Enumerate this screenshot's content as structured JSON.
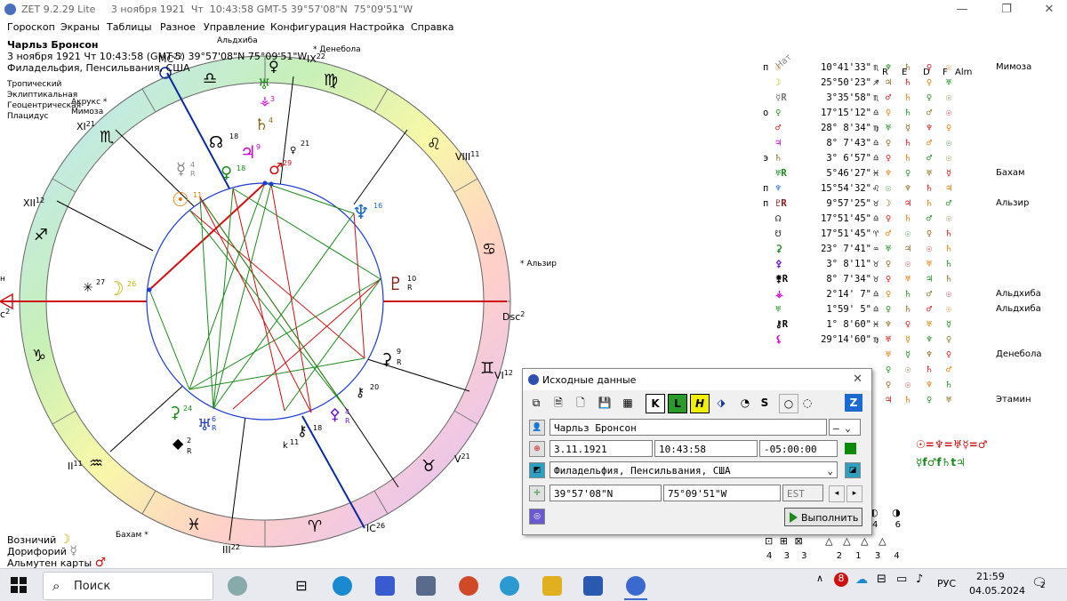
{
  "window": {
    "title": "ZET 9.2.29 Lite     3 ноября 1921  Чт  10:43:58 GMT-5 39°57'08\"N  75°09'51\"W",
    "minimize": "—",
    "restore": "❐",
    "close": "✕"
  },
  "menu": [
    "Гороскоп",
    "Экраны",
    "Таблицы",
    "Разное",
    "Управление",
    "Конфигурация",
    "Настройка",
    "Справка"
  ],
  "person": {
    "name": "Чарльз Бронсон",
    "datetime": "3 ноября 1921  Чт  10:43:58 (GMT-5) 39°57'08\"N  75°09'51\"W",
    "place": "Филадельфия, Пенсильвания, США"
  },
  "system": [
    "Тропический",
    "Эклиптикальная",
    "Геоцентрическая",
    "Плацидус"
  ],
  "chart_labels": {
    "mc": "MC",
    "mc_deg": "22",
    "asc_left": "н",
    "asc_c": "c",
    "asc_deg": "2",
    "dsc": "Dsc",
    "dsc_deg": "2",
    "ic": "IC",
    "ic_deg": "26",
    "houses": [
      {
        "n": "IX",
        "d": "22"
      },
      {
        "n": "VIII",
        "d": "11"
      },
      {
        "n": "VI",
        "d": "12"
      },
      {
        "n": "V",
        "d": "21"
      },
      {
        "n": "III",
        "d": "22"
      },
      {
        "n": "II",
        "d": "11"
      },
      {
        "n": "XII",
        "d": "12"
      },
      {
        "n": "XI",
        "d": "21"
      }
    ],
    "stars": [
      "Альдхиба",
      "Денебола",
      "Акрукс",
      "Мимоза",
      "Альзир",
      "Бахам"
    ],
    "planet_degrees": {
      "moon": "26",
      "star27": "27",
      "sun": "11",
      "mercury": "4",
      "venus": "18",
      "jupiter": "9",
      "node": "18",
      "mars": "29",
      "uranus": "3",
      "saturn": "4",
      "d21": "21",
      "neptune": "16",
      "pluto": "10",
      "d9": "9",
      "d20": "20",
      "d4b": "4",
      "d18b": "18",
      "k11": "11",
      "d24": "24",
      "d6": "6",
      "d2": "2"
    },
    "retro": "R"
  },
  "bottom_left": [
    "Возничий",
    "Дорифорий",
    "Альмутен карты"
  ],
  "positions": {
    "headers": {
      "nat": "Нат",
      "r": "R",
      "e": "E",
      "d": "D",
      "f": "F",
      "alm": "Alm"
    },
    "rows": [
      {
        "mk": "п",
        "gl": "☉",
        "deg": "10°41'33\"",
        "sg": "♏",
        "c": [
          "♆",
          "♄",
          "♀",
          "☉"
        ],
        "star": "Мимоза",
        "col": "#e07a00"
      },
      {
        "mk": "",
        "gl": "☽",
        "deg": "25°50'23\"",
        "sg": "♐",
        "c": [
          "♃",
          "♄",
          "♀",
          "♅"
        ],
        "star": "",
        "col": "#c8b400"
      },
      {
        "mk": "",
        "gl": "☿R",
        "deg": "3°35'58\"",
        "sg": "♏",
        "c": [
          "♂",
          "♄",
          "♀",
          "☉"
        ],
        "star": "",
        "col": "#777"
      },
      {
        "mk": "о",
        "gl": "♀",
        "deg": "17°15'12\"",
        "sg": "♎",
        "c": [
          "♀",
          "♄",
          "♂",
          "☉"
        ],
        "star": "",
        "col": "#1a8a1a"
      },
      {
        "mk": "",
        "gl": "♂",
        "deg": "28° 8'34\"",
        "sg": "♍",
        "c": [
          "♅",
          "☿",
          "♆",
          "♀"
        ],
        "star": "",
        "col": "#d01010"
      },
      {
        "mk": "",
        "gl": "♃",
        "deg": "8° 7'43\"",
        "sg": "♎",
        "c": [
          "♀",
          "♄",
          "♂",
          "☉"
        ],
        "star": "",
        "col": "#d000d0"
      },
      {
        "mk": "э",
        "gl": "♄",
        "deg": "3° 6'57\"",
        "sg": "♎",
        "c": [
          "♀",
          "♄",
          "♂",
          "☉"
        ],
        "star": "",
        "col": "#8a6a1a"
      },
      {
        "mk": "",
        "gl": "♅R",
        "deg": "5°46'27\"",
        "sg": "♓",
        "c": [
          "♆",
          "♀",
          "♅",
          "☿"
        ],
        "star": "Бахам",
        "col": "#1a8a1a"
      },
      {
        "mk": "п",
        "gl": "♆",
        "deg": "15°54'32\"",
        "sg": "♌",
        "c": [
          "☉",
          "♆",
          "♄",
          "♃"
        ],
        "star": "",
        "col": "#1a6ad0"
      },
      {
        "mk": "п",
        "gl": "♇R",
        "deg": "9°57'25\"",
        "sg": "♉",
        "c": [
          "☽",
          "♃",
          "♄",
          "♂"
        ],
        "star": "Альзир",
        "col": "#8a1a1a"
      },
      {
        "mk": "",
        "gl": "☊",
        "deg": "17°51'45\"",
        "sg": "♎",
        "c": [
          "♀",
          "♄",
          "♂",
          "☉"
        ],
        "star": "",
        "col": "#000"
      },
      {
        "mk": "",
        "gl": "☋",
        "deg": "17°51'45\"",
        "sg": "♈",
        "c": [
          "♂",
          "☉",
          "♀",
          "♄"
        ],
        "star": "",
        "col": "#000"
      },
      {
        "mk": "",
        "gl": "⚳",
        "deg": "23° 7'41\"",
        "sg": "♒",
        "c": [
          "♅",
          "♃",
          "☉",
          "♄"
        ],
        "star": "",
        "col": "#1a8a1a"
      },
      {
        "mk": "",
        "gl": "⚴",
        "deg": "3° 8'11\"",
        "sg": "♉",
        "c": [
          "♀",
          "☉",
          "♅",
          "♄"
        ],
        "star": "",
        "col": "#6a1ad0"
      },
      {
        "mk": "",
        "gl": "⚵R",
        "deg": "8° 7'34\"",
        "sg": "♉",
        "c": [
          "♀",
          "♅",
          "♃",
          "♄"
        ],
        "star": "",
        "col": "#000"
      },
      {
        "mk": "",
        "gl": "⚶",
        "deg": "2°14' 7\"",
        "sg": "♎",
        "c": [
          "♀",
          "♄",
          "♂",
          "☉"
        ],
        "star": "Альдхиба",
        "col": "#d000d0"
      },
      {
        "mk": "",
        "gl": "♅",
        "deg": "1°59' 5\"",
        "sg": "♎",
        "c": [
          "♀",
          "♄",
          "♂",
          "☉"
        ],
        "star": "Альдхиба",
        "col": "#1a8a1a"
      },
      {
        "mk": "",
        "gl": "⚷R",
        "deg": "1° 8'60\"",
        "sg": "♓",
        "c": [
          "♆",
          "♀",
          "♅",
          "☿"
        ],
        "star": "",
        "col": "#000"
      },
      {
        "mk": "",
        "gl": "⚸",
        "deg": "29°14'60\"",
        "sg": "♍",
        "c": [
          "♅",
          "☿",
          "♆",
          "♀"
        ],
        "star": "",
        "col": "#d000d0"
      },
      {
        "mk": "",
        "gl": "",
        "deg": "",
        "sg": "",
        "c": [
          "♅",
          "☿",
          "♆",
          "♀"
        ],
        "star": "Денебола",
        "col": "#000"
      },
      {
        "mk": "",
        "gl": "",
        "deg": "",
        "sg": "",
        "c": [
          "♀",
          "☉",
          "♄",
          "♂"
        ],
        "star": "",
        "col": "#000"
      },
      {
        "mk": "",
        "gl": "",
        "deg": "",
        "sg": "",
        "c": [
          "♀",
          "☉",
          "♆",
          "♄"
        ],
        "star": "",
        "col": "#000"
      },
      {
        "mk": "",
        "gl": "",
        "deg": "",
        "sg": "",
        "c": [
          "♃",
          "♄",
          "♀",
          "♅"
        ],
        "star": "Этамин",
        "col": "#000"
      }
    ]
  },
  "aspect_formula": {
    "line1": "☉=♆=♅☿=♂",
    "line2": "☿f♂f♄t♃"
  },
  "dialog": {
    "title": "Исходные данные",
    "close": "✕",
    "toolbar": [
      "⧉",
      "🗎",
      "🗋",
      "💾",
      "▦",
      "K",
      "L",
      "H",
      "⬗",
      "◔",
      "S",
      "○",
      "◌",
      "Z"
    ],
    "name_value": "Чарльз Бронсон",
    "gender_value": "—",
    "date_value": "3.11.1921",
    "time_value": "10:43:58",
    "tz_value": "-05:00:00",
    "place_value": "Филадельфия, Пенсильвания, США",
    "lat_value": "39°57'08\"N",
    "lon_value": "75°09'51\"W",
    "est": "EST",
    "run_label": "Выполнить"
  },
  "bottom_right": {
    "icons_top": [
      "◐",
      "◑"
    ],
    "nums_top": [
      "4",
      "6"
    ],
    "icons_bottom": [
      "⊡",
      "⊞",
      "⊠",
      "△",
      "△",
      "△",
      "△"
    ],
    "nums_bottom": [
      "4",
      "3",
      "3",
      "2",
      "1",
      "3",
      "4"
    ]
  },
  "taskbar": {
    "search_placeholder": "Поиск",
    "lang": "РУС",
    "time": "21:59",
    "date": "04.05.2024",
    "notif": "2"
  }
}
